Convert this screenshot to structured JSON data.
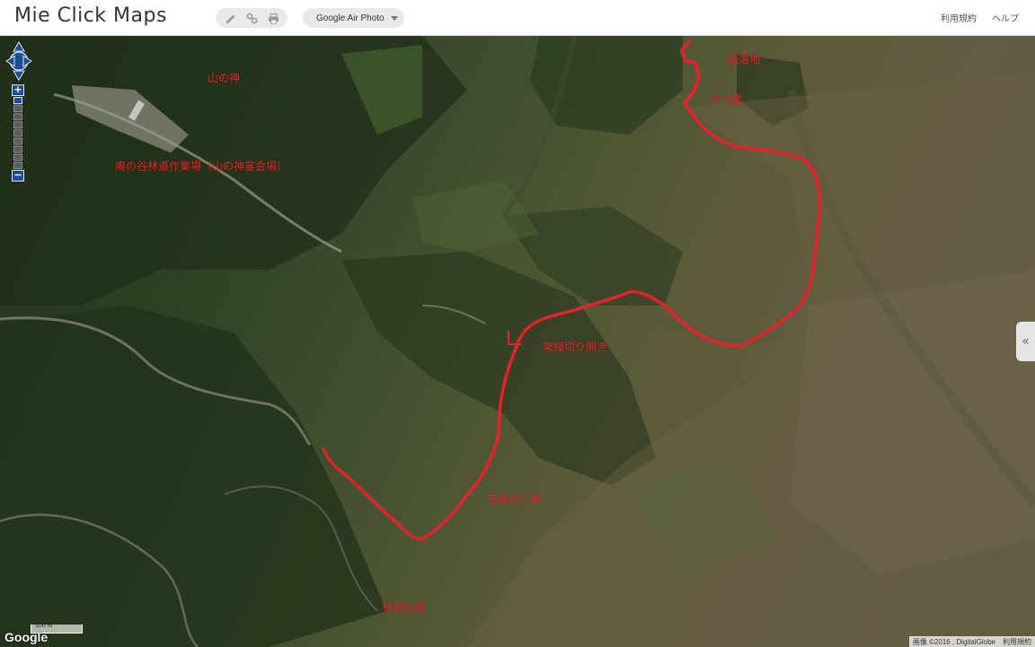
{
  "app": {
    "title": "Mie Click Maps"
  },
  "toolbar": {
    "icons": [
      "pencil-icon",
      "link-icon",
      "print-icon"
    ],
    "layer": {
      "selected": "Google Air Photo"
    }
  },
  "nav": {
    "terms": "利用規約",
    "help": "ヘルプ"
  },
  "map": {
    "labels": {
      "yama_no_kami": "山の神",
      "workplace": "庵の谷林道作業場（山の神宴会場）",
      "collapse": "崩落地",
      "bear_trap": "クマ檻",
      "cable_clearing": "架線切り開き",
      "fork": "右俣の二俣",
      "forest_road": "林道支線"
    },
    "route_color": "#e8222a",
    "zoom_controls": {
      "zoom_in": "+",
      "zoom_out": "−"
    },
    "side_panel_toggle": "«",
    "scale_label": "100 m",
    "logo": "Google",
    "attribution": {
      "imagery": "画像 ©2016 , DigitalGlobe",
      "terms": "利用規約"
    }
  }
}
